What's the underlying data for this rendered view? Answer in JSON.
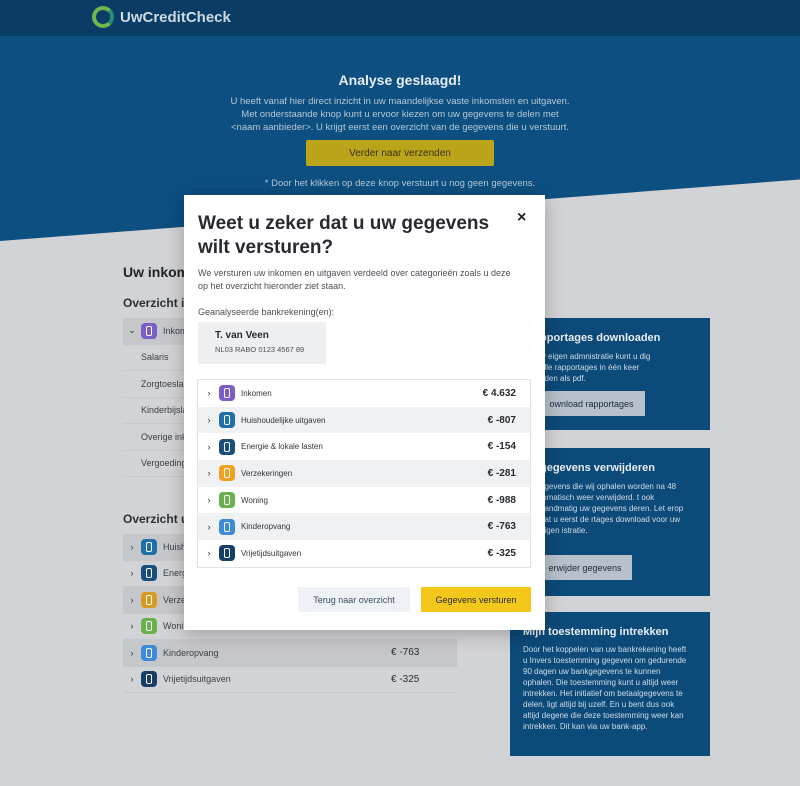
{
  "app": {
    "brand": "UwCreditCheck"
  },
  "hero": {
    "title": "Analyse geslaagd!",
    "text": "U heeft vanaf hier direct inzicht in uw maandelijkse vaste inkomsten en uitgaven. Met onderstaande knop kunt u ervoor kiezen om uw gegevens te delen met <naam aanbieder>. U krijgt eerst een overzicht van de gegevens die u verstuurt.",
    "button": "Verder naar verzenden",
    "note": "* Door het klikken op deze knop verstuurt u nog geen gegevens."
  },
  "background": {
    "heading": "Uw inkom",
    "income_title": "Overzicht i",
    "income_row": "Inkom",
    "income_subs": [
      "Salaris",
      "Zorgtoesla",
      "Kinderbijsla",
      "Overige ink",
      "Vergoedinge"
    ],
    "expense_title": "Overzicht u",
    "expense_rows": [
      {
        "label": "Huish",
        "amount": ""
      },
      {
        "label": "Energ",
        "amount": ""
      },
      {
        "label": "Verze",
        "amount": ""
      },
      {
        "label": "Wonin",
        "amount": ""
      },
      {
        "label": "Kinderopvang",
        "amount": "€ -763"
      },
      {
        "label": "Vrijetijdsuitgaven",
        "amount": "€ -325"
      }
    ],
    "card1": {
      "title": "pportages downloaden",
      "text": "w eigen admnistratie kunt u dig alle rapportages in één keer aden als pdf.",
      "button": "ownload rapportages"
    },
    "card2": {
      "title": "gegevens verwijderen",
      "text": "egevens die wij ophalen worden na 48 tomatisch weer verwijderd. t ook handmatig uw gegevens deren. Let erop dat u eerst de rtages download voor uw eigen istratie.",
      "button": "erwijder gegevens"
    },
    "card3": {
      "title": "Mijn toestemming intrekken",
      "text": "Door het koppelen van uw bankrekening heeft u Invers toestemming gegeven om gedurende 90 dagen uw bankgegevens te kunnen ophalen. Die toestemming kunt u altijd weer intrekken. Het initiatief om betaalgegevens te delen, ligt altijd bij uzelf. En u bent dus ook altijd degene die deze toestemming weer kan intrekken. Dit kan via uw bank-app."
    }
  },
  "modal": {
    "title": "Weet u zeker dat u uw gegevens wilt versturen?",
    "close": "×",
    "description": "We versturen uw inkomen en uitgaven verdeeld over categorieën zoals u deze op het overzicht hieronder ziet staan.",
    "accounts_label": "Geanalyseerde bankrekening(en):",
    "account": {
      "name": "T. van Veen",
      "iban": "NL03 RABO 0123 4567 89"
    },
    "categories": [
      {
        "label": "Inkomen",
        "amount": "€ 4.632",
        "color": "#7b5fc7"
      },
      {
        "label": "Huishoudelijke uitgaven",
        "amount": "€ -807",
        "color": "#1f6fa8"
      },
      {
        "label": "Energie & lokale lasten",
        "amount": "€ -154",
        "color": "#1a4f7c"
      },
      {
        "label": "Verzekeringen",
        "amount": "€ -281",
        "color": "#f0a21e"
      },
      {
        "label": "Woning",
        "amount": "€ -988",
        "color": "#6ab04c"
      },
      {
        "label": "Kinderopvang",
        "amount": "€ -763",
        "color": "#3c8ad8"
      },
      {
        "label": "Vrijetijdsuitgaven",
        "amount": "€ -325",
        "color": "#173f66"
      }
    ],
    "back_button": "Terug naar overzicht",
    "send_button": "Gegevens versturen"
  }
}
